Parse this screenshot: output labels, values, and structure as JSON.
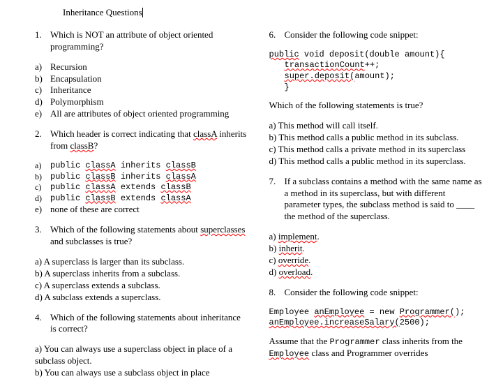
{
  "title": "Inheritance Questions",
  "q1": {
    "num": "1.",
    "text": "Which is NOT an attribute of object oriented programming?",
    "opts": {
      "a": "Recursion",
      "b": "Encapsulation",
      "c": "Inheritance",
      "d": "Polymorphism",
      "e": "All are attributes of object oriented programming"
    }
  },
  "q2": {
    "num": "2.",
    "t1": "Which header is correct indicating that ",
    "s1": "classA",
    "t2": " inherits from ",
    "s2": "classB",
    "t3": "?",
    "opts": {
      "a1": "public ",
      "a2": "classA",
      "a3": " inherits ",
      "a4": "classB",
      "b1": "public ",
      "b2": "classB",
      "b3": " inherits ",
      "b4": "classA",
      "c1": "public ",
      "c2": "classA",
      "c3": " extends ",
      "c4": "classB",
      "d1": "public ",
      "d2": "classB",
      "d3": " extends ",
      "d4": "classA",
      "e": "none of these are correct"
    }
  },
  "q3": {
    "num": "3.",
    "t1": "Which of the following statements about ",
    "s1": "superclasses",
    "t2": " and subclasses is true?",
    "opts": {
      "a": "a) A superclass is larger than its subclass.",
      "b": "b) A superclass inherits from a subclass.",
      "c": "c) A superclass extends a subclass.",
      "d": "d) A subclass extends a superclass."
    }
  },
  "q4": {
    "num": "4.",
    "text": "Which of the following statements about inheritance is correct?",
    "opts": {
      "a": "a) You can always use a superclass object in place of a subclass object.",
      "b": "b) You can always use a subclass object in place"
    }
  },
  "q6": {
    "num": "6.",
    "text": "Consider the following code snippet:",
    "code": {
      "l1a": "public",
      "l1b": " void deposit(double amount){",
      "l2a": "transactionCount",
      "l2b": "++;",
      "l3a": "super.deposit(",
      "l3b": "amount);",
      "l4": "}"
    },
    "follow": "Which of the following statements is true?",
    "opts": {
      "a": "a) This method will call itself.",
      "b": "b) This method calls a public method in its subclass.",
      "c": "c) This method calls a private method in its superclass",
      "d": "d) This method calls a public method in its superclass."
    }
  },
  "q7": {
    "num": "7.",
    "text": "If a subclass contains a method with the same name as a method in its superclass, but with different parameter types, the subclass method is said to ____ the method of the superclass.",
    "opts": {
      "a1": "a) ",
      "a2": "implement",
      "a3": ".",
      "b1": "b) ",
      "b2": "inherit",
      "b3": ".",
      "c1": "c) ",
      "c2": "override",
      "c3": ".",
      "d1": "d) ",
      "d2": "overload",
      "d3": "."
    }
  },
  "q8": {
    "num": "8.",
    "text": "Consider the following code snippet:",
    "code": {
      "l1a": "Employee ",
      "l1b": "anEmployee",
      "l1c": " = new ",
      "l1d": "Programmer(",
      "l1e": ");",
      "l2a": "anEmployee.increaseSalary(",
      "l2b": "2500);"
    },
    "f1": "Assume that the ",
    "f2": "Programmer",
    "f3": " class inherits from the ",
    "f4": "Employee",
    "f5": " class and Programmer overrides"
  }
}
